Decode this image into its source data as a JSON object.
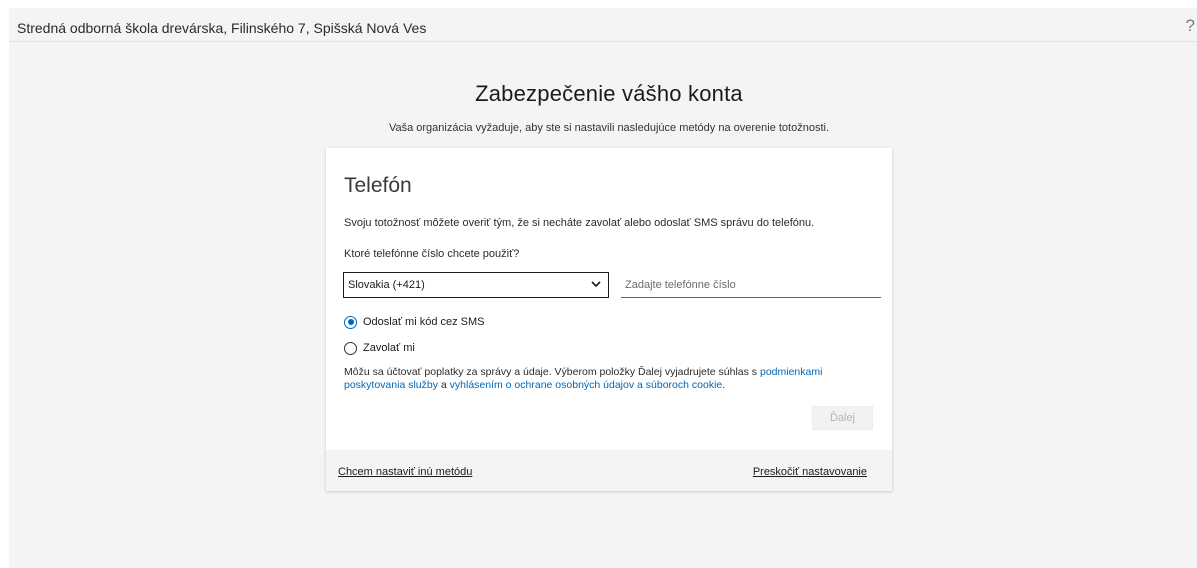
{
  "header": {
    "org_name": "Stredná odborná škola drevárska, Filinského 7, Spišská Nová Ves",
    "help_icon": "?"
  },
  "page": {
    "title": "Zabezpečenie vášho konta",
    "subtitle": "Vaša organizácia vyžaduje, aby ste si nastavili nasledujúce metódy na overenie totožnosti."
  },
  "card": {
    "title": "Telefón",
    "description": "Svoju totožnosť môžete overiť tým, že si necháte zavolať alebo odoslať SMS správu do telefónu.",
    "question": "Ktoré telefónne číslo chcete použiť?",
    "country_select": {
      "value": "Slovakia (+421)"
    },
    "phone_input": {
      "value": "",
      "placeholder": "Zadajte telefónne číslo"
    },
    "options": [
      {
        "label": "Odoslať mi kód cez SMS",
        "checked": true
      },
      {
        "label": "Zavolať mi",
        "checked": false
      }
    ],
    "legal": {
      "text_before": "Môžu sa účtovať poplatky za správy a údaje. Výberom položky Ďalej vyjadrujete súhlas s ",
      "link_terms": "podmienkami poskytovania služby",
      "text_middle": " a ",
      "link_privacy": "vyhlásením o ochrane osobných údajov a súboroch cookie",
      "text_after": "."
    },
    "next_button": "Ďalej"
  },
  "footer": {
    "other_method_link": "Chcem nastaviť inú metódu",
    "skip_link": "Preskočiť nastavovanie"
  },
  "colors": {
    "accent": "#0067b8",
    "page_background": "#f4f4f4",
    "disabled_text": "#b5b5b5"
  }
}
